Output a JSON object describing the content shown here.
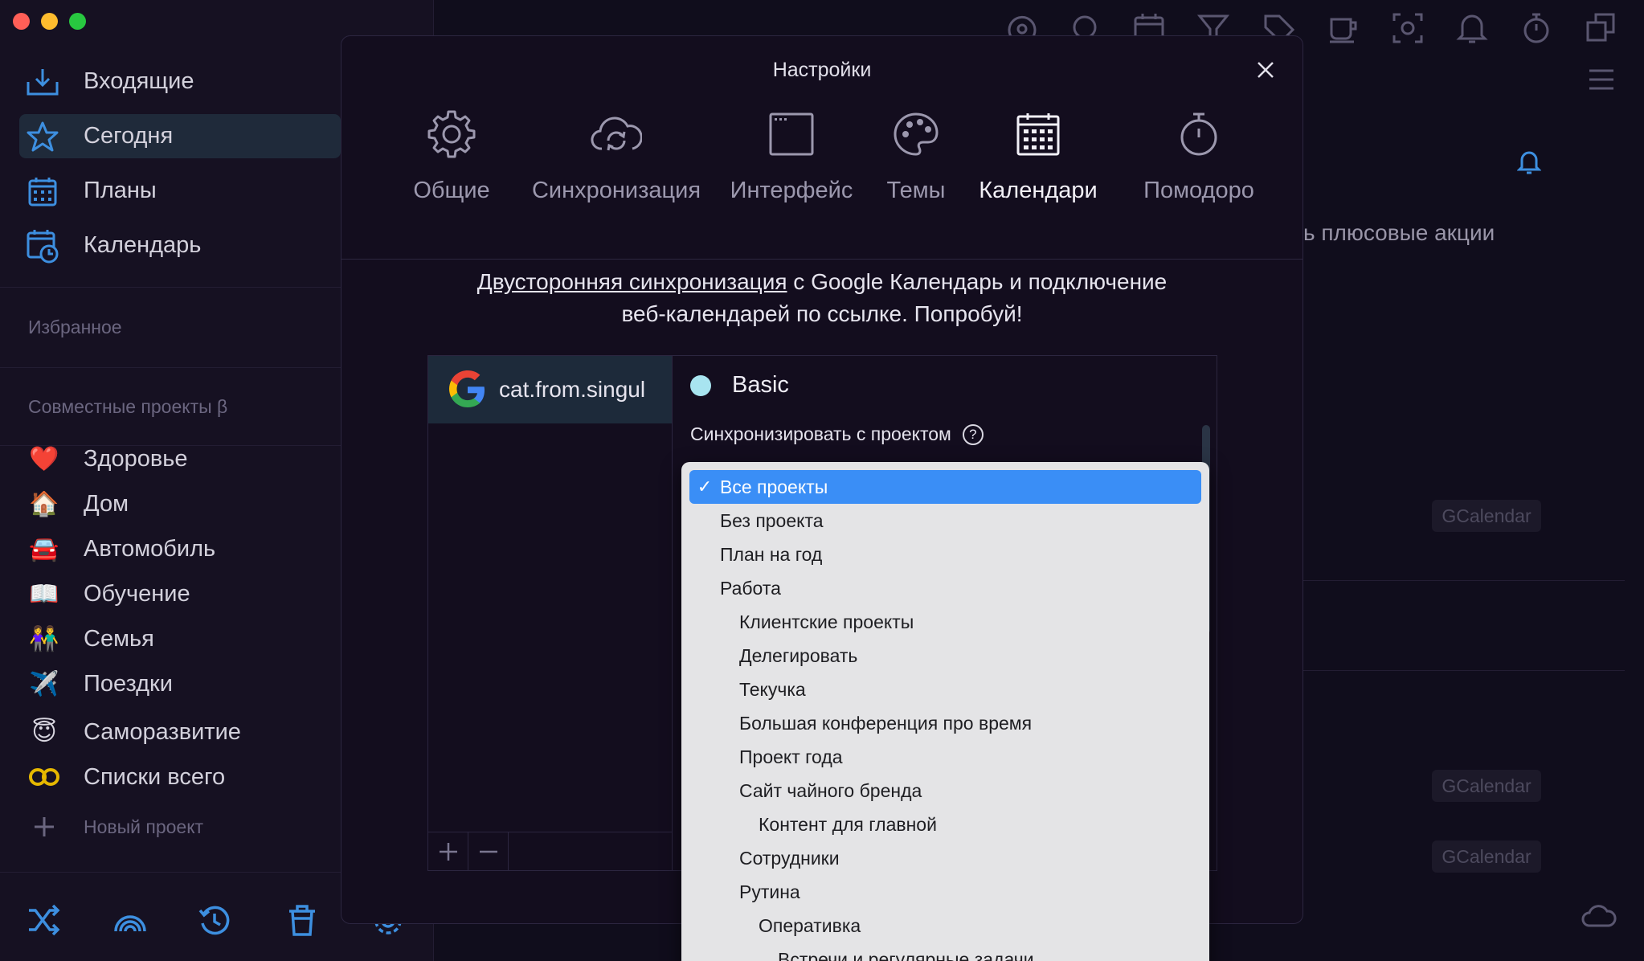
{
  "sidebar": {
    "nav": [
      {
        "label": "Входящие",
        "icon": "inbox-icon"
      },
      {
        "label": "Сегодня",
        "icon": "star-icon"
      },
      {
        "label": "Планы",
        "icon": "plans-icon"
      },
      {
        "label": "Календарь",
        "icon": "calendar-clock-icon"
      }
    ],
    "favorites_title": "Избранное",
    "shared_title": "Совместные проекты β",
    "projects": [
      {
        "label": "Здоровье",
        "emoji": "❤️"
      },
      {
        "label": "Дом",
        "emoji": "🏠"
      },
      {
        "label": "Автомобиль",
        "emoji": "🚘"
      },
      {
        "label": "Обучение",
        "emoji": "📖"
      },
      {
        "label": "Семья",
        "emoji": "👫"
      },
      {
        "label": "Поездки",
        "emoji": "✈️"
      },
      {
        "label": "Саморазвитие",
        "emoji": "😇"
      },
      {
        "label": "Списки всего",
        "emoji": "➿"
      }
    ],
    "new_project": "Новый проект"
  },
  "background": {
    "promo_fragment": "ь плюсовые акции",
    "gcal_badge": "GCalendar"
  },
  "modal": {
    "title": "Настройки",
    "tabs": [
      {
        "label": "Общие",
        "icon": "gear-icon"
      },
      {
        "label": "Синхронизация",
        "icon": "cloud-sync-icon"
      },
      {
        "label": "Интерфейс",
        "icon": "window-icon"
      },
      {
        "label": "Темы",
        "icon": "palette-icon"
      },
      {
        "label": "Календари",
        "icon": "calendar-icon",
        "active": true
      },
      {
        "label": "Помодоро",
        "icon": "stopwatch-icon"
      }
    ],
    "promo_link": "Двусторонняя синхронизация",
    "promo_rest": " с Google Календарь и подключение",
    "promo_line2": "веб-календарей по ссылке. Попробуй!",
    "account_email": "cat.from.singul",
    "calendar_name": "Basic",
    "calendar_color": "#a8e4f0",
    "sync_label": "Синхронизировать с проектом",
    "help": "?"
  },
  "dropdown": {
    "items": [
      {
        "label": "Все проекты",
        "selected": true
      },
      {
        "label": "Без проекта"
      },
      {
        "label": "План на год"
      },
      {
        "label": "Работа"
      },
      {
        "label": "Клиентские проекты",
        "level": 1
      },
      {
        "label": "Делегировать",
        "level": 1
      },
      {
        "label": "Текучка",
        "level": 1
      },
      {
        "label": "Большая конференция про время",
        "level": 1
      },
      {
        "label": "Проект года",
        "level": 1
      },
      {
        "label": "Сайт чайного бренда",
        "level": 1
      },
      {
        "label": "Контент для главной",
        "level": 2
      },
      {
        "label": "Сотрудники",
        "level": 1
      },
      {
        "label": "Рутина",
        "level": 1
      },
      {
        "label": "Оперативка",
        "level": 2
      },
      {
        "label": "Встречи и регулярные задачи",
        "level": 3
      }
    ]
  },
  "colors": {
    "accent": "#3a8ef6",
    "star": "#3d8fe0"
  }
}
